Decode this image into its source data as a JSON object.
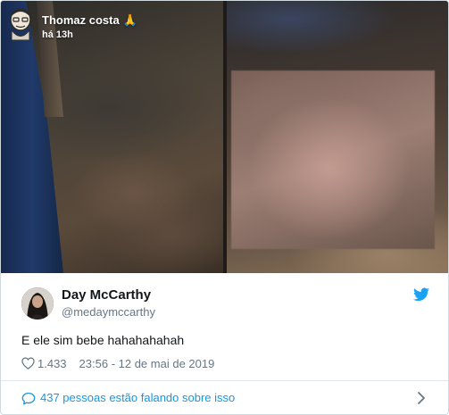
{
  "snap": {
    "name": "Thomaz costa",
    "emoji": "🙏",
    "time": "há 13h"
  },
  "tweet": {
    "author_name": "Day McCarthy",
    "author_handle": "@medaymccarthy",
    "text": "E ele sim bebe hahahahahah",
    "like_count": "1.433",
    "timestamp": "23:56 - 12 de mai de 2019"
  },
  "footer": {
    "conversation_text": "437 pessoas estão falando sobre isso"
  },
  "icons": {
    "twitter": "twitter-bird-icon",
    "heart": "heart-icon",
    "bubble": "speech-bubble-icon",
    "chevron": "chevron-right-icon"
  },
  "colors": {
    "twitter_blue": "#1da1f2",
    "link_blue": "#1b95e0",
    "muted": "#657786"
  }
}
